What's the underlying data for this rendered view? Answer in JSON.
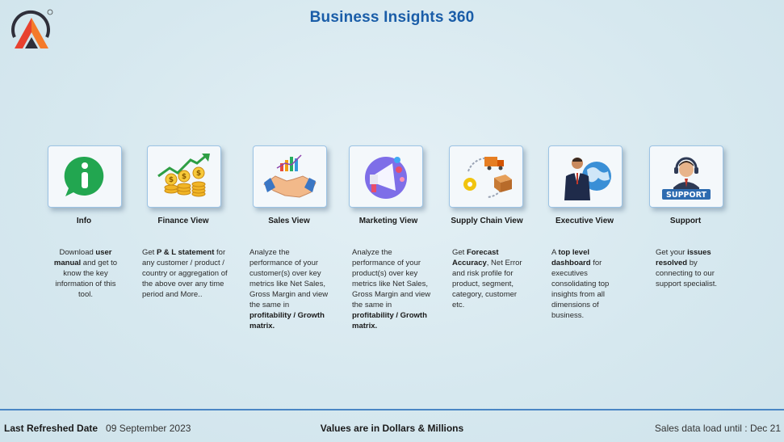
{
  "header": {
    "title": "Business Insights 360",
    "logo_icon": "atliq-logo-icon"
  },
  "tiles": [
    {
      "label": "Info",
      "icon": "info-icon",
      "desc": [
        {
          "t": "Download "
        },
        {
          "t": "user manual",
          "b": true
        },
        {
          "t": " and get to know the key information of this tool."
        }
      ]
    },
    {
      "label": "Finance View",
      "icon": "finance-growth-icon",
      "desc": [
        {
          "t": "Get  "
        },
        {
          "t": "P & L statement",
          "b": true
        },
        {
          "t": " for any customer / product / country or aggregation of the above over any time period and More.."
        }
      ]
    },
    {
      "label": "Sales View",
      "icon": "handshake-icon",
      "desc": [
        {
          "t": "Analyze the performance of your customer(s) over key metrics like Net Sales, Gross Margin and view the same in "
        },
        {
          "t": "profitability / Growth matrix.",
          "b": true
        }
      ]
    },
    {
      "label": "Marketing View",
      "icon": "megaphone-icon",
      "desc": [
        {
          "t": "Analyze the performance of your product(s) over key metrics like Net Sales, Gross Margin and view the same in "
        },
        {
          "t": "profitability / Growth matrix.",
          "b": true
        }
      ]
    },
    {
      "label": "Supply Chain View",
      "icon": "supply-chain-icon",
      "desc": [
        {
          "t": "Get "
        },
        {
          "t": "Forecast Accuracy",
          "b": true
        },
        {
          "t": ", Net Error and risk profile for product, segment, category, customer etc."
        }
      ]
    },
    {
      "label": "Executive View",
      "icon": "executive-globe-icon",
      "desc": [
        {
          "t": "A "
        },
        {
          "t": "top level dashboard",
          "b": true
        },
        {
          "t": " for executives consolidating top insights from all dimensions of business."
        }
      ]
    },
    {
      "label": "Support",
      "icon": "support-agent-icon",
      "support_badge": "SUPPORT",
      "desc": [
        {
          "t": "Get your "
        },
        {
          "t": "issues resolved",
          "b": true
        },
        {
          "t": " by connecting to our support specialist."
        }
      ]
    }
  ],
  "footer": {
    "last_refreshed_label": "Last Refreshed Date",
    "last_refreshed_value": "09 September 2023",
    "units_note": "Values are in Dollars & Millions",
    "sales_load": "Sales data load until : Dec 21"
  },
  "colors": {
    "title": "#1a5da8",
    "card_border": "#9cc3e4",
    "footer_line": "#4a86c4"
  }
}
